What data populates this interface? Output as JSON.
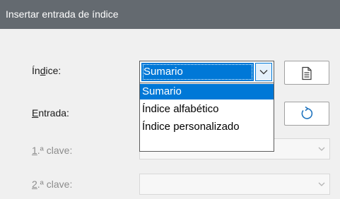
{
  "window": {
    "title": "Insertar entrada de índice"
  },
  "form": {
    "index_label_pre": "Ín",
    "index_label_key": "d",
    "index_label_post": "ice:",
    "entry_label_key": "E",
    "entry_label_post": "ntrada:",
    "key1_label_key": "1",
    "key1_label_post": ".ª clave:",
    "key2_label_key": "2",
    "key2_label_post": ".ª clave:"
  },
  "index_select": {
    "value": "Sumario",
    "options": [
      "Sumario",
      "Índice alfabético",
      "Índice personalizado"
    ],
    "selected_index": 0
  },
  "icons": {
    "new_index_button": "document-icon",
    "update_button": "refresh-icon",
    "dropdown": "chevron-down-icon"
  },
  "colors": {
    "accent": "#0078d7",
    "titlebar": "#646a70",
    "dialog_bg": "#f0f0f0"
  }
}
